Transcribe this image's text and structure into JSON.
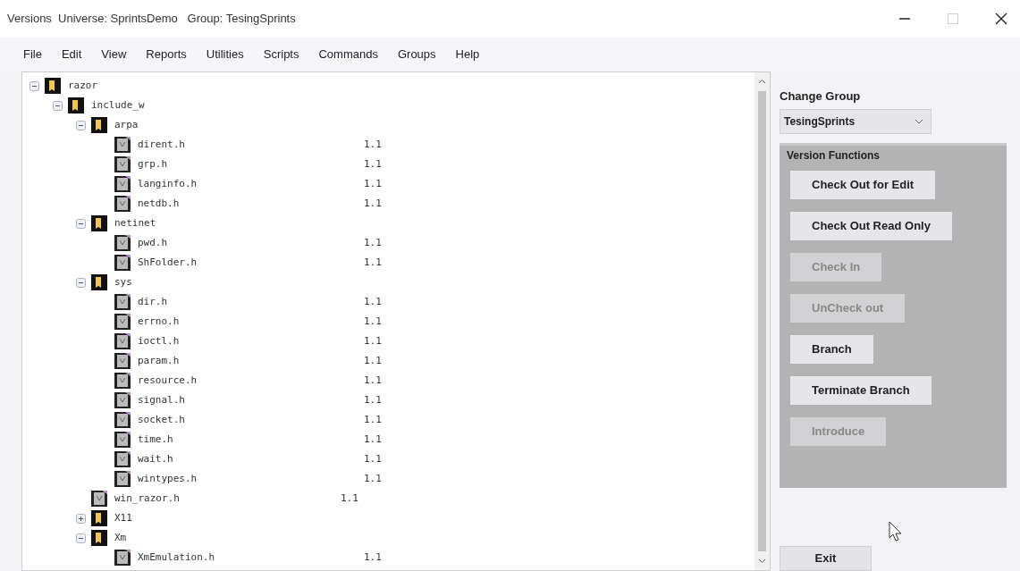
{
  "window": {
    "title": "Versions  Universe: SprintsDemo   Group: TesingSprints"
  },
  "menu": [
    "File",
    "Edit",
    "View",
    "Reports",
    "Utilities",
    "Scripts",
    "Commands",
    "Groups",
    "Help"
  ],
  "tree": [
    {
      "kind": "folder",
      "name": "razor",
      "expanded": true,
      "children": [
        {
          "kind": "folder",
          "name": "include_w",
          "expanded": true,
          "children": [
            {
              "kind": "folder",
              "name": "arpa",
              "expanded": true,
              "children": [
                {
                  "kind": "file",
                  "name": "dirent.h",
                  "version": "1.1"
                },
                {
                  "kind": "file",
                  "name": "grp.h",
                  "version": "1.1"
                },
                {
                  "kind": "file",
                  "name": "langinfo.h",
                  "version": "1.1"
                },
                {
                  "kind": "file",
                  "name": "netdb.h",
                  "version": "1.1"
                }
              ]
            },
            {
              "kind": "folder",
              "name": "netinet",
              "expanded": true,
              "children": [
                {
                  "kind": "file",
                  "name": "pwd.h",
                  "version": "1.1"
                },
                {
                  "kind": "file",
                  "name": "ShFolder.h",
                  "version": "1.1"
                }
              ]
            },
            {
              "kind": "folder",
              "name": "sys",
              "expanded": true,
              "children": [
                {
                  "kind": "file",
                  "name": "dir.h",
                  "version": "1.1"
                },
                {
                  "kind": "file",
                  "name": "errno.h",
                  "version": "1.1"
                },
                {
                  "kind": "file",
                  "name": "ioctl.h",
                  "version": "1.1"
                },
                {
                  "kind": "file",
                  "name": "param.h",
                  "version": "1.1"
                },
                {
                  "kind": "file",
                  "name": "resource.h",
                  "version": "1.1"
                },
                {
                  "kind": "file",
                  "name": "signal.h",
                  "version": "1.1"
                },
                {
                  "kind": "file",
                  "name": "socket.h",
                  "version": "1.1"
                },
                {
                  "kind": "file",
                  "name": "time.h",
                  "version": "1.1"
                },
                {
                  "kind": "file",
                  "name": "wait.h",
                  "version": "1.1"
                },
                {
                  "kind": "file",
                  "name": "wintypes.h",
                  "version": "1.1"
                }
              ]
            },
            {
              "kind": "file",
              "name": "win_razor.h",
              "version": "1.1"
            },
            {
              "kind": "folder",
              "name": "X11",
              "expanded": false
            },
            {
              "kind": "folder",
              "name": "Xm",
              "expanded": true,
              "children": [
                {
                  "kind": "file",
                  "name": "XmEmulation.h",
                  "version": "1.1"
                }
              ]
            }
          ]
        }
      ]
    }
  ],
  "change_group": {
    "label": "Change Group",
    "value": "TesingSprints"
  },
  "version_functions": {
    "title": "Version Functions",
    "buttons": [
      {
        "label": "Check Out for Edit",
        "disabled": false
      },
      {
        "label": "Check Out Read Only",
        "disabled": false
      },
      {
        "label": "Check In",
        "disabled": true
      },
      {
        "label": "UnCheck out",
        "disabled": true
      },
      {
        "label": "Branch",
        "disabled": false
      },
      {
        "label": "Terminate Branch",
        "disabled": false
      },
      {
        "label": "Introduce",
        "disabled": true
      }
    ]
  },
  "exit_button": "Exit"
}
